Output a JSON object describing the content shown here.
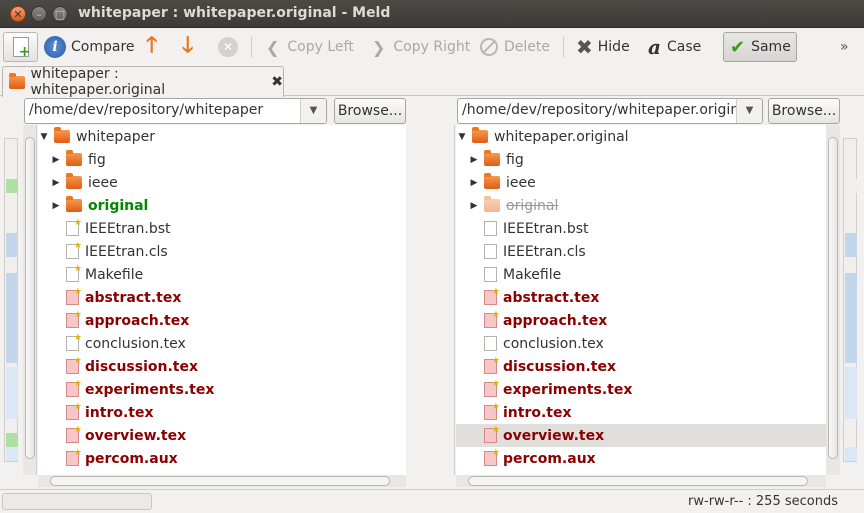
{
  "window": {
    "title": "whitepaper : whitepaper.original - Meld"
  },
  "toolbar": {
    "compare": "Compare",
    "copy_left": "Copy Left",
    "copy_right": "Copy Right",
    "delete": "Delete",
    "hide": "Hide",
    "case": "Case",
    "same": "Same"
  },
  "tab": {
    "label": "whitepaper : whitepaper.original"
  },
  "left": {
    "path": "/home/dev/repository/whitepaper",
    "browse": "Browse...",
    "rows": [
      {
        "name": "whitepaper",
        "kind": "folder",
        "state": "normal",
        "expander": "▼",
        "depth": 0
      },
      {
        "name": "fig",
        "kind": "folder",
        "state": "normal",
        "expander": "▶",
        "depth": 1
      },
      {
        "name": "ieee",
        "kind": "folder",
        "state": "normal",
        "expander": "▶",
        "depth": 1
      },
      {
        "name": "original",
        "kind": "folder",
        "state": "new",
        "expander": "▶",
        "depth": 1
      },
      {
        "name": "IEEEtran.bst",
        "kind": "file",
        "state": "normal",
        "depth": 1
      },
      {
        "name": "IEEEtran.cls",
        "kind": "file",
        "state": "normal",
        "depth": 1
      },
      {
        "name": "Makefile",
        "kind": "file",
        "state": "normal",
        "depth": 1
      },
      {
        "name": "abstract.tex",
        "kind": "file",
        "state": "changed",
        "depth": 1
      },
      {
        "name": "approach.tex",
        "kind": "file",
        "state": "changed",
        "depth": 1
      },
      {
        "name": "conclusion.tex",
        "kind": "file",
        "state": "normal",
        "depth": 1
      },
      {
        "name": "discussion.tex",
        "kind": "file",
        "state": "changed",
        "depth": 1
      },
      {
        "name": "experiments.tex",
        "kind": "file",
        "state": "changed",
        "depth": 1
      },
      {
        "name": "intro.tex",
        "kind": "file",
        "state": "changed",
        "depth": 1
      },
      {
        "name": "overview.tex",
        "kind": "file",
        "state": "changed",
        "depth": 1
      },
      {
        "name": "percom.aux",
        "kind": "file",
        "state": "changed",
        "depth": 1
      }
    ]
  },
  "right": {
    "path": "/home/dev/repository/whitepaper.original",
    "browse": "Browse...",
    "rows": [
      {
        "name": "whitepaper.original",
        "kind": "folder",
        "state": "normal",
        "expander": "▼",
        "depth": 0
      },
      {
        "name": "fig",
        "kind": "folder",
        "state": "normal",
        "expander": "▶",
        "depth": 1
      },
      {
        "name": "ieee",
        "kind": "folder",
        "state": "normal",
        "expander": "▶",
        "depth": 1
      },
      {
        "name": "original",
        "kind": "folder",
        "state": "missing",
        "expander": "▶",
        "depth": 1
      },
      {
        "name": "IEEEtran.bst",
        "kind": "file",
        "state": "normal",
        "depth": 1
      },
      {
        "name": "IEEEtran.cls",
        "kind": "file",
        "state": "normal",
        "depth": 1
      },
      {
        "name": "Makefile",
        "kind": "file",
        "state": "normal",
        "depth": 1
      },
      {
        "name": "abstract.tex",
        "kind": "file",
        "state": "changed",
        "depth": 1
      },
      {
        "name": "approach.tex",
        "kind": "file",
        "state": "changed",
        "depth": 1
      },
      {
        "name": "conclusion.tex",
        "kind": "file",
        "state": "normal",
        "depth": 1
      },
      {
        "name": "discussion.tex",
        "kind": "file",
        "state": "changed",
        "depth": 1
      },
      {
        "name": "experiments.tex",
        "kind": "file",
        "state": "changed",
        "depth": 1
      },
      {
        "name": "intro.tex",
        "kind": "file",
        "state": "changed",
        "depth": 1
      },
      {
        "name": "overview.tex",
        "kind": "file",
        "state": "changed",
        "depth": 1,
        "selected": true
      },
      {
        "name": "percom.aux",
        "kind": "file",
        "state": "changed",
        "depth": 1
      }
    ]
  },
  "status": {
    "text": "rw-rw-r-- : 255 seconds"
  },
  "colors": {
    "changed": "#8b0000",
    "new": "#008800",
    "missing": "#999999",
    "modified_file": "#f7c7c7",
    "folder": "#e25c14"
  },
  "icons": [
    "new-comparison-icon",
    "info-icon",
    "up-arrow-icon",
    "down-arrow-icon",
    "stop-icon",
    "copy-left-icon",
    "copy-right-icon",
    "delete-icon",
    "hide-icon",
    "case-icon",
    "same-icon",
    "folder-icon",
    "file-icon",
    "close-icon"
  ]
}
